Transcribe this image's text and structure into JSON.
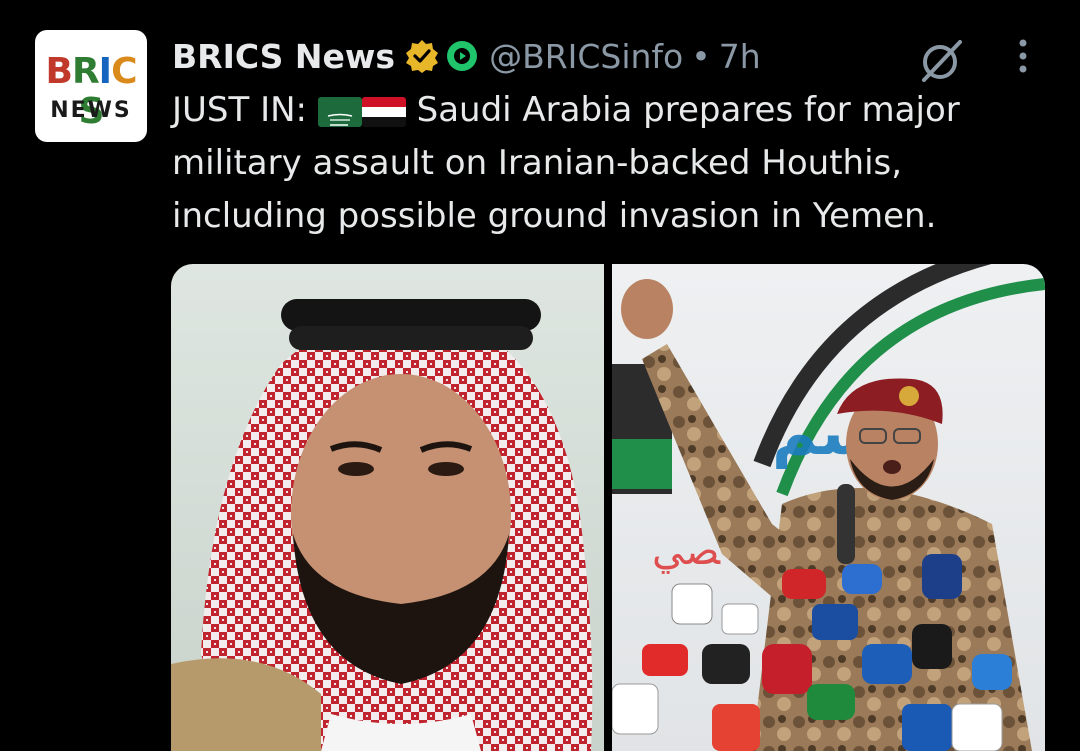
{
  "tweet": {
    "display_name": "BRICS News",
    "handle": "@BRICSinfo",
    "separator": "•",
    "time": "7h",
    "text_prefix": "JUST IN:",
    "text_body": "Saudi Arabia prepares for major military assault on Iranian-backed Houthis, including possible ground invasion in Yemen.",
    "flags": [
      "saudi-arabia-flag",
      "yemen-flag"
    ]
  },
  "avatar": {
    "logo_top": "BRICS",
    "logo_bottom": "NEWS"
  },
  "icons": {
    "verified_badge": "gold-checkmark-badge",
    "affiliate_badge": "green-circle-badge",
    "grok": "grok-icon",
    "more": "more-options-icon"
  },
  "colors": {
    "background": "#000000",
    "primary_text": "#e7e9ea",
    "secondary_text": "#8b98a5",
    "verified_gold": "#e8b629",
    "affiliate_green": "#1fc46b"
  },
  "media": {
    "left_image": "portrait-man-red-white-keffiyeh",
    "right_image": "man-in-military-uniform-raised-fist-at-microphones"
  }
}
